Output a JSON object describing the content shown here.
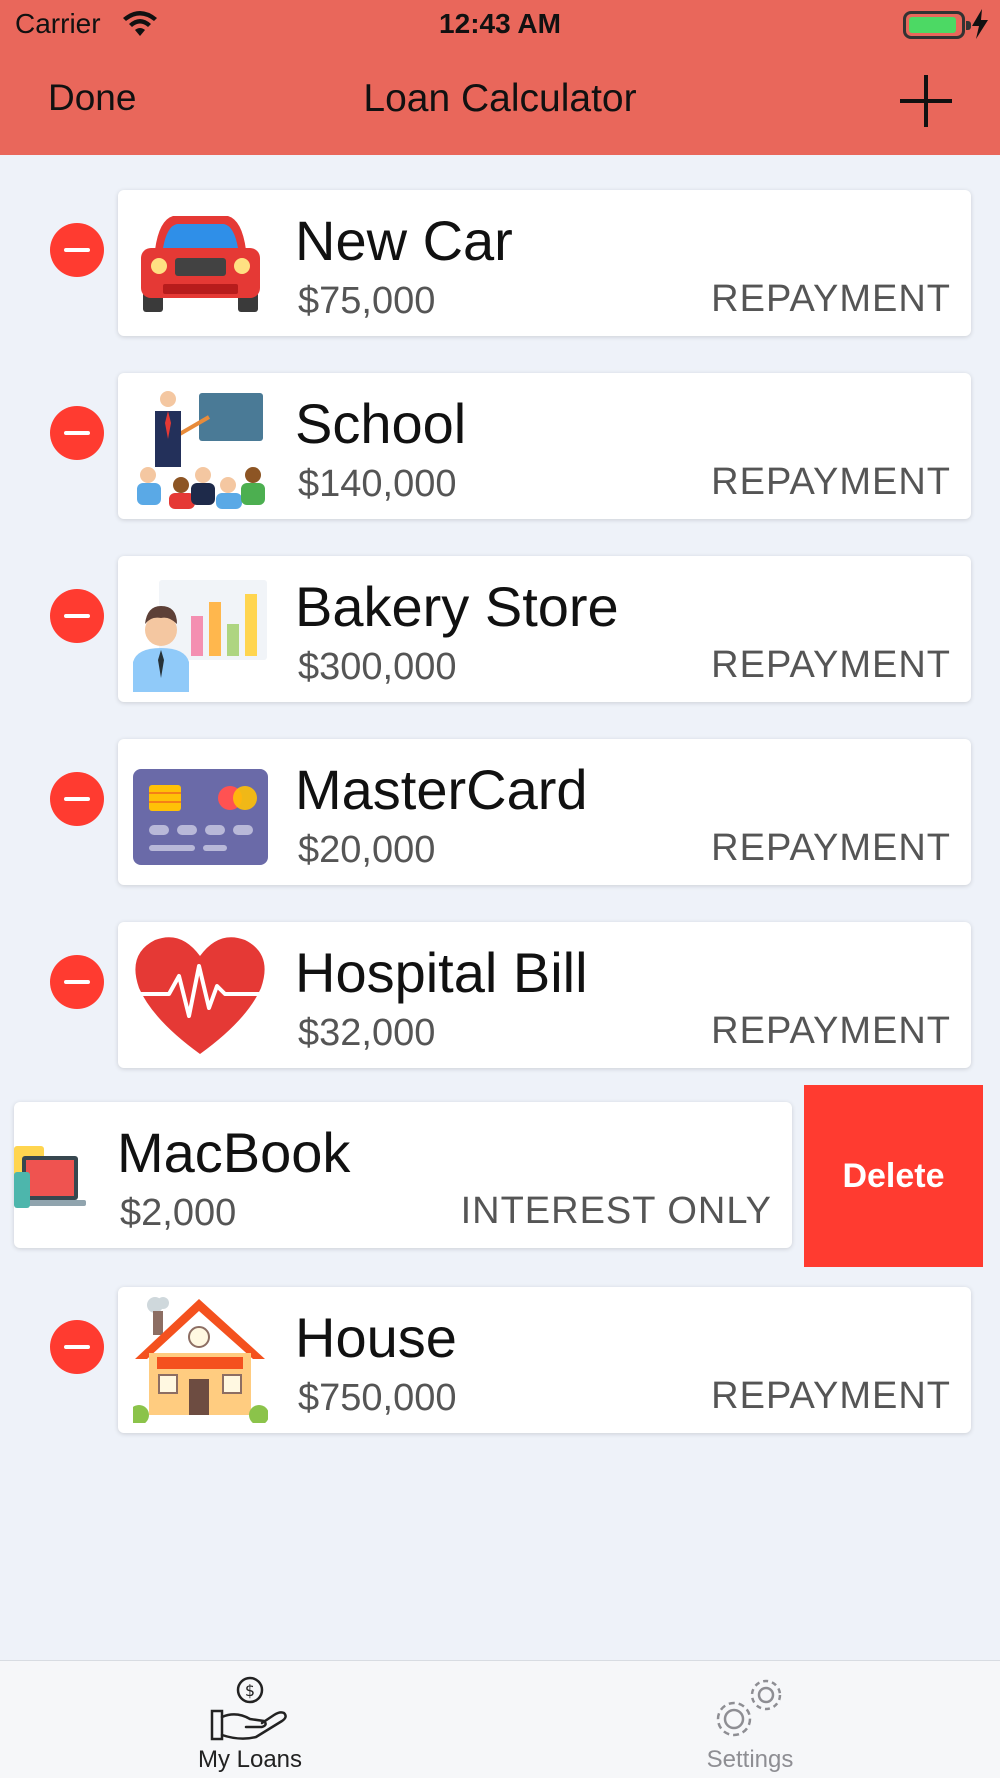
{
  "status_bar": {
    "carrier": "Carrier",
    "time": "12:43 AM",
    "battery_color": "#4CD964"
  },
  "nav": {
    "left_button": "Done",
    "title": "Loan Calculator",
    "right_icon": "plus-icon",
    "background": "#E9675B"
  },
  "loans": [
    {
      "name": "New Car",
      "amount": "$75,000",
      "type": "REPAYMENT",
      "icon": "car-icon"
    },
    {
      "name": "School",
      "amount": "$140,000",
      "type": "REPAYMENT",
      "icon": "teacher-classroom-icon"
    },
    {
      "name": "Bakery Store",
      "amount": "$300,000",
      "type": "REPAYMENT",
      "icon": "businessman-chart-icon"
    },
    {
      "name": "MasterCard",
      "amount": "$20,000",
      "type": "REPAYMENT",
      "icon": "credit-card-icon"
    },
    {
      "name": "Hospital Bill",
      "amount": "$32,000",
      "type": "REPAYMENT",
      "icon": "heart-pulse-icon"
    },
    {
      "name": "MacBook",
      "amount": "$2,000",
      "type": "INTEREST ONLY",
      "icon": "devices-icon",
      "delete_label": "Delete"
    },
    {
      "name": "House",
      "amount": "$750,000",
      "type": "REPAYMENT",
      "icon": "house-icon"
    }
  ],
  "delete_color": "#FF3B30",
  "tabbar": {
    "tabs": [
      {
        "label": "My Loans",
        "icon": "hand-dollar-icon",
        "active": true
      },
      {
        "label": "Settings",
        "icon": "gears-icon",
        "active": false
      }
    ]
  }
}
